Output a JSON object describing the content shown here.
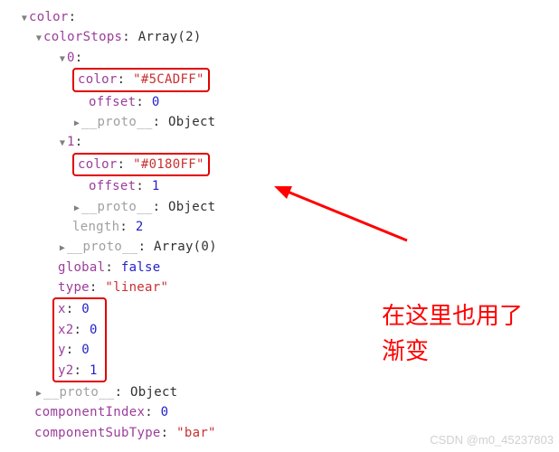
{
  "l0": {
    "key": "color"
  },
  "l1": {
    "key": "colorStops",
    "val": "Array(2)"
  },
  "l2": {
    "key": "0"
  },
  "l3": {
    "key": "color",
    "val": "\"#5CADFF\""
  },
  "l4": {
    "key": "offset",
    "val": "0"
  },
  "l5": {
    "key": "__proto__",
    "val": "Object"
  },
  "l6": {
    "key": "1"
  },
  "l7": {
    "key": "color",
    "val": "\"#0180FF\""
  },
  "l8": {
    "key": "offset",
    "val": "1"
  },
  "l9": {
    "key": "__proto__",
    "val": "Object"
  },
  "l10": {
    "key": "length",
    "val": "2"
  },
  "l11": {
    "key": "__proto__",
    "val": "Array(0)"
  },
  "l12": {
    "key": "global",
    "val": "false"
  },
  "l13": {
    "key": "type",
    "val": "\"linear\""
  },
  "l14": {
    "key": "x",
    "val": "0"
  },
  "l15": {
    "key": "x2",
    "val": "0"
  },
  "l16": {
    "key": "y",
    "val": "0"
  },
  "l17": {
    "key": "y2",
    "val": "1"
  },
  "l18": {
    "key": "__proto__",
    "val": "Object"
  },
  "l19": {
    "key": "componentIndex",
    "val": "0"
  },
  "l20": {
    "key": "componentSubType",
    "val": "\"bar\""
  },
  "annotation": {
    "line1": "在这里也用了",
    "line2": "渐变"
  },
  "watermark": "CSDN @m0_45237803"
}
